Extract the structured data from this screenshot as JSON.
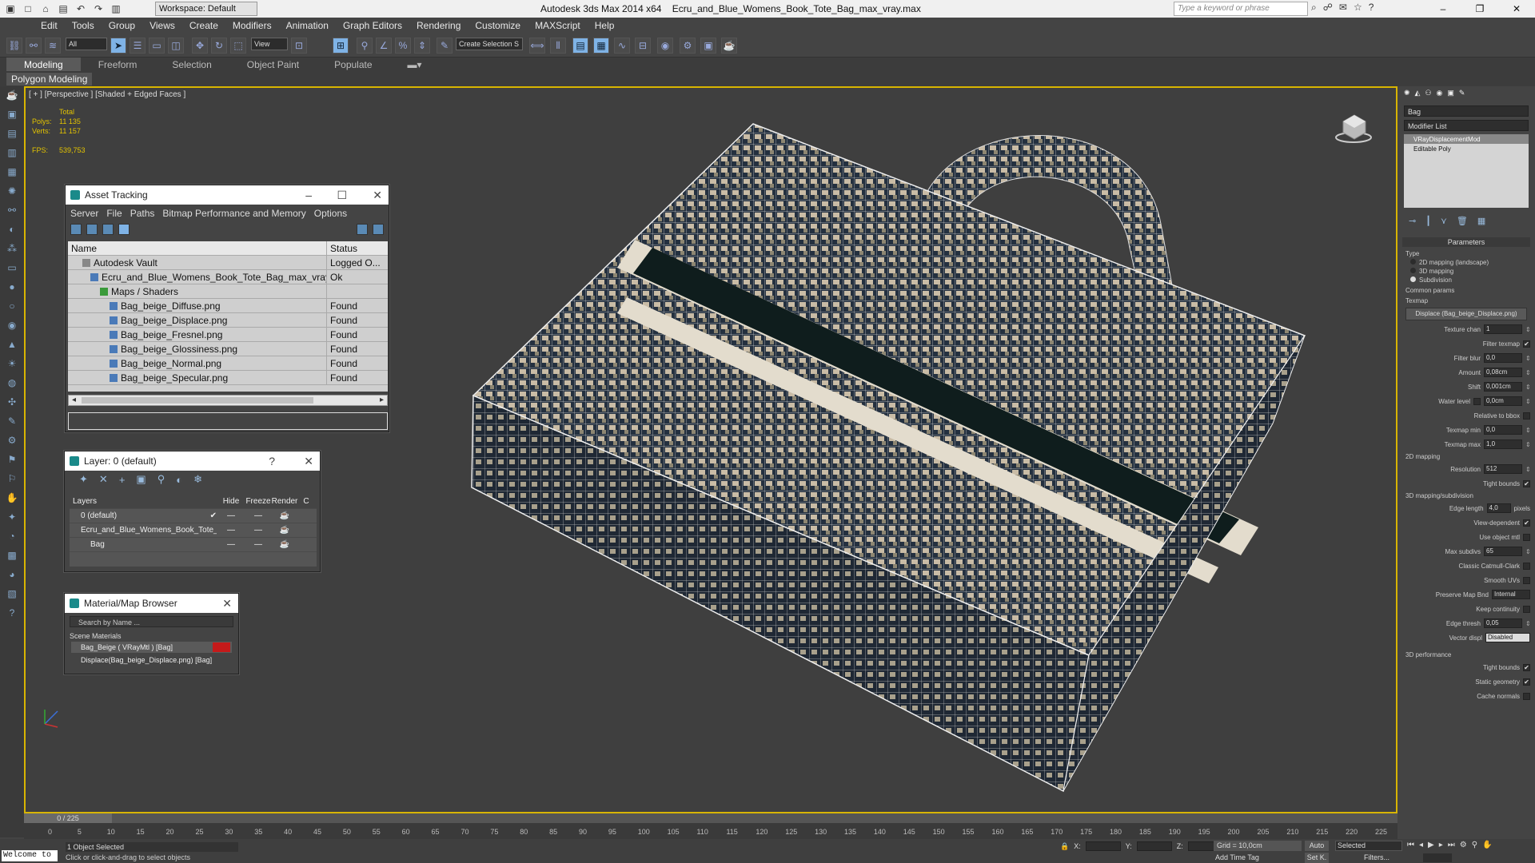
{
  "titlebar": {
    "workspace": "Workspace: Default",
    "app_title": "Autodesk 3ds Max  2014 x64",
    "file_title": "Ecru_and_Blue_Womens_Book_Tote_Bag_max_vray.max",
    "search_placeholder": "Type a keyword or phrase"
  },
  "menu": [
    "Edit",
    "Tools",
    "Group",
    "Views",
    "Create",
    "Modifiers",
    "Animation",
    "Graph Editors",
    "Rendering",
    "Customize",
    "MAXScript",
    "Help"
  ],
  "toolbar": {
    "filter": "All",
    "ref_coord": "View",
    "named_sel": "Create Selection S"
  },
  "ribbon": {
    "tabs": [
      "Modeling",
      "Freeform",
      "Selection",
      "Object Paint",
      "Populate"
    ],
    "active_tab": "Modeling",
    "panel": "Polygon Modeling"
  },
  "viewport": {
    "label": "[ + ] [Perspective ] [Shaded + Edged Faces ]",
    "stats_header": "Total",
    "polys_label": "Polys:",
    "polys": "11 135",
    "verts_label": "Verts:",
    "verts": "11 157",
    "fps_label": "FPS:",
    "fps": "539,753"
  },
  "asset_tracking": {
    "title": "Asset Tracking",
    "menu": [
      "Server",
      "File",
      "Paths",
      "Bitmap Performance and Memory",
      "Options"
    ],
    "col_name": "Name",
    "col_status": "Status",
    "rows": [
      {
        "name": "Autodesk Vault",
        "status": "Logged O..."
      },
      {
        "name": "Ecru_and_Blue_Womens_Book_Tote_Bag_max_vray.max",
        "status": "Ok"
      },
      {
        "name": "Maps / Shaders",
        "status": ""
      },
      {
        "name": "Bag_beige_Diffuse.png",
        "status": "Found"
      },
      {
        "name": "Bag_beige_Displace.png",
        "status": "Found"
      },
      {
        "name": "Bag_beige_Fresnel.png",
        "status": "Found"
      },
      {
        "name": "Bag_beige_Glossiness.png",
        "status": "Found"
      },
      {
        "name": "Bag_beige_Normal.png",
        "status": "Found"
      },
      {
        "name": "Bag_beige_Specular.png",
        "status": "Found"
      }
    ]
  },
  "layer": {
    "title": "Layer: 0 (default)",
    "help": "?",
    "cols": [
      "Layers",
      "Hide",
      "Freeze",
      "Render",
      "C"
    ],
    "rows": [
      {
        "name": "0 (default)",
        "hide": "—",
        "freeze": "—"
      },
      {
        "name": "Ecru_and_Blue_Womens_Book_Tote_Bag",
        "hide": "—",
        "freeze": "—"
      },
      {
        "name": "Bag",
        "hide": "—",
        "freeze": "—"
      }
    ]
  },
  "mat_browser": {
    "title": "Material/Map Browser",
    "search": "Search by Name ...",
    "section": "Scene Materials",
    "items": [
      "Bag_Beige ( VRayMtl ) [Bag]",
      "Displace(Bag_beige_Displace.png) [Bag]"
    ]
  },
  "command_panel": {
    "object_name": "Bag",
    "modifier_list": "Modifier List",
    "stack": [
      "VRayDisplacementMod",
      "Editable Poly"
    ],
    "params_header": "Parameters",
    "type_label": "Type",
    "type_options": [
      "2D mapping (landscape)",
      "3D mapping",
      "Subdivision"
    ],
    "common_label": "Common params",
    "texmap_label": "Texmap",
    "texmap_button": "Displace (Bag_beige_Displace.png)",
    "texture_chan_label": "Texture chan",
    "texture_chan": "1",
    "filter_texmap_label": "Filter texmap",
    "filter_blur_label": "Filter blur",
    "filter_blur": "0,0",
    "amount_label": "Amount",
    "amount": "0,08cm",
    "shift_label": "Shift",
    "shift": "0,001cm",
    "water_level_label": "Water level",
    "water_level": "0,0cm",
    "relative_label": "Relative to bbox",
    "texmap_min_label": "Texmap min",
    "texmap_min": "0,0",
    "texmap_max_label": "Texmap max",
    "texmap_max": "1,0",
    "map2d_label": "2D mapping",
    "resolution_label": "Resolution",
    "resolution": "512",
    "tight_bounds_label": "Tight bounds",
    "map3d_label": "3D mapping/subdivision",
    "edge_length_label": "Edge length",
    "edge_length": "4,0",
    "pixels_label": "pixels",
    "view_dependent_label": "View-dependent",
    "use_object_mtl_label": "Use object mtl",
    "max_subdivs_label": "Max subdivs",
    "max_subdivs": "65",
    "classic_label": "Classic Catmull-Clark",
    "smooth_uvs_label": "Smooth UVs",
    "preserve_label": "Preserve Map Bnd",
    "preserve": "Internal",
    "keep_cont_label": "Keep continuity",
    "edge_thresh_label": "Edge thresh",
    "edge_thresh": "0,05",
    "vector_label": "Vector displ",
    "vector": "Disabled",
    "perf_label": "3D performance",
    "tight2_label": "Tight bounds",
    "static_label": "Static geometry",
    "cache_label": "Cache normals"
  },
  "timeline": {
    "slider": "0 / 225",
    "ticks": [
      "0",
      "5",
      "10",
      "15",
      "20",
      "25",
      "30",
      "35",
      "40",
      "45",
      "50",
      "55",
      "60",
      "65",
      "70",
      "75",
      "80",
      "85",
      "90",
      "95",
      "100",
      "105",
      "110",
      "115",
      "120",
      "125",
      "130",
      "135",
      "140",
      "145",
      "150",
      "155",
      "160",
      "165",
      "170",
      "175",
      "180",
      "185",
      "190",
      "195",
      "200",
      "205",
      "210",
      "215",
      "220",
      "225"
    ]
  },
  "status": {
    "welcome": "Welcome to",
    "selection": "1 Object Selected",
    "prompt": "Click or click-and-drag to select objects",
    "x_label": "X:",
    "y_label": "Y:",
    "z_label": "Z:",
    "grid": "Grid = 10,0cm",
    "add_time_tag": "Add Time Tag",
    "auto": "Auto",
    "set_key": "Set K.",
    "selected": "Selected",
    "filters": "Filters..."
  }
}
